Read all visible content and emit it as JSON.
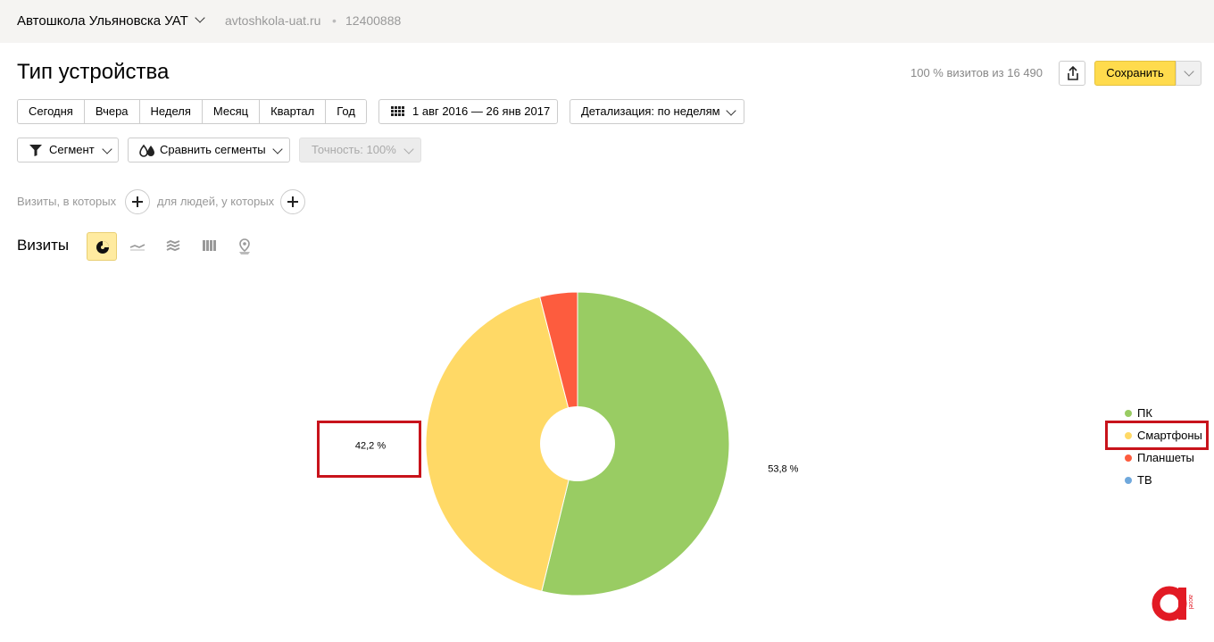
{
  "header": {
    "site_name": "Автошкола Ульяновска УАТ",
    "site_url": "avtoshkola-uat.ru",
    "separator": "•",
    "counter_id": "12400888"
  },
  "report": {
    "title": "Тип устройства",
    "visits_summary": "100 % визитов из 16 490",
    "save_label": "Сохранить",
    "share_icon": "share-icon"
  },
  "periods": [
    "Сегодня",
    "Вчера",
    "Неделя",
    "Месяц",
    "Квартал",
    "Год"
  ],
  "date_range": "1 авг 2016 — 26 янв 2017",
  "detail": "Детализация: по неделям",
  "segment_label": "Сегмент",
  "compare_label": "Сравнить сегменты",
  "accuracy_label": "Точность: 100%",
  "conditions": {
    "visits_label": "Визиты, в которых",
    "people_label": "для людей, у которых"
  },
  "section_label": "Визиты",
  "viz_icons": [
    "pie-chart-icon",
    "line-chart-icon",
    "area-chart-icon",
    "bar-chart-icon",
    "map-icon"
  ],
  "chart_data": {
    "type": "pie",
    "donut": true,
    "categories": [
      "ПК",
      "Смартфоны",
      "Планшеты",
      "ТВ"
    ],
    "values": [
      53.8,
      42.2,
      4.0,
      0.0
    ],
    "colors": [
      "#99cc63",
      "#ffd966",
      "#fd5c3e",
      "#6fa8dc"
    ],
    "data_labels": [
      "53,8 %",
      "42,2 %",
      "",
      ""
    ],
    "legend_position": "right"
  }
}
